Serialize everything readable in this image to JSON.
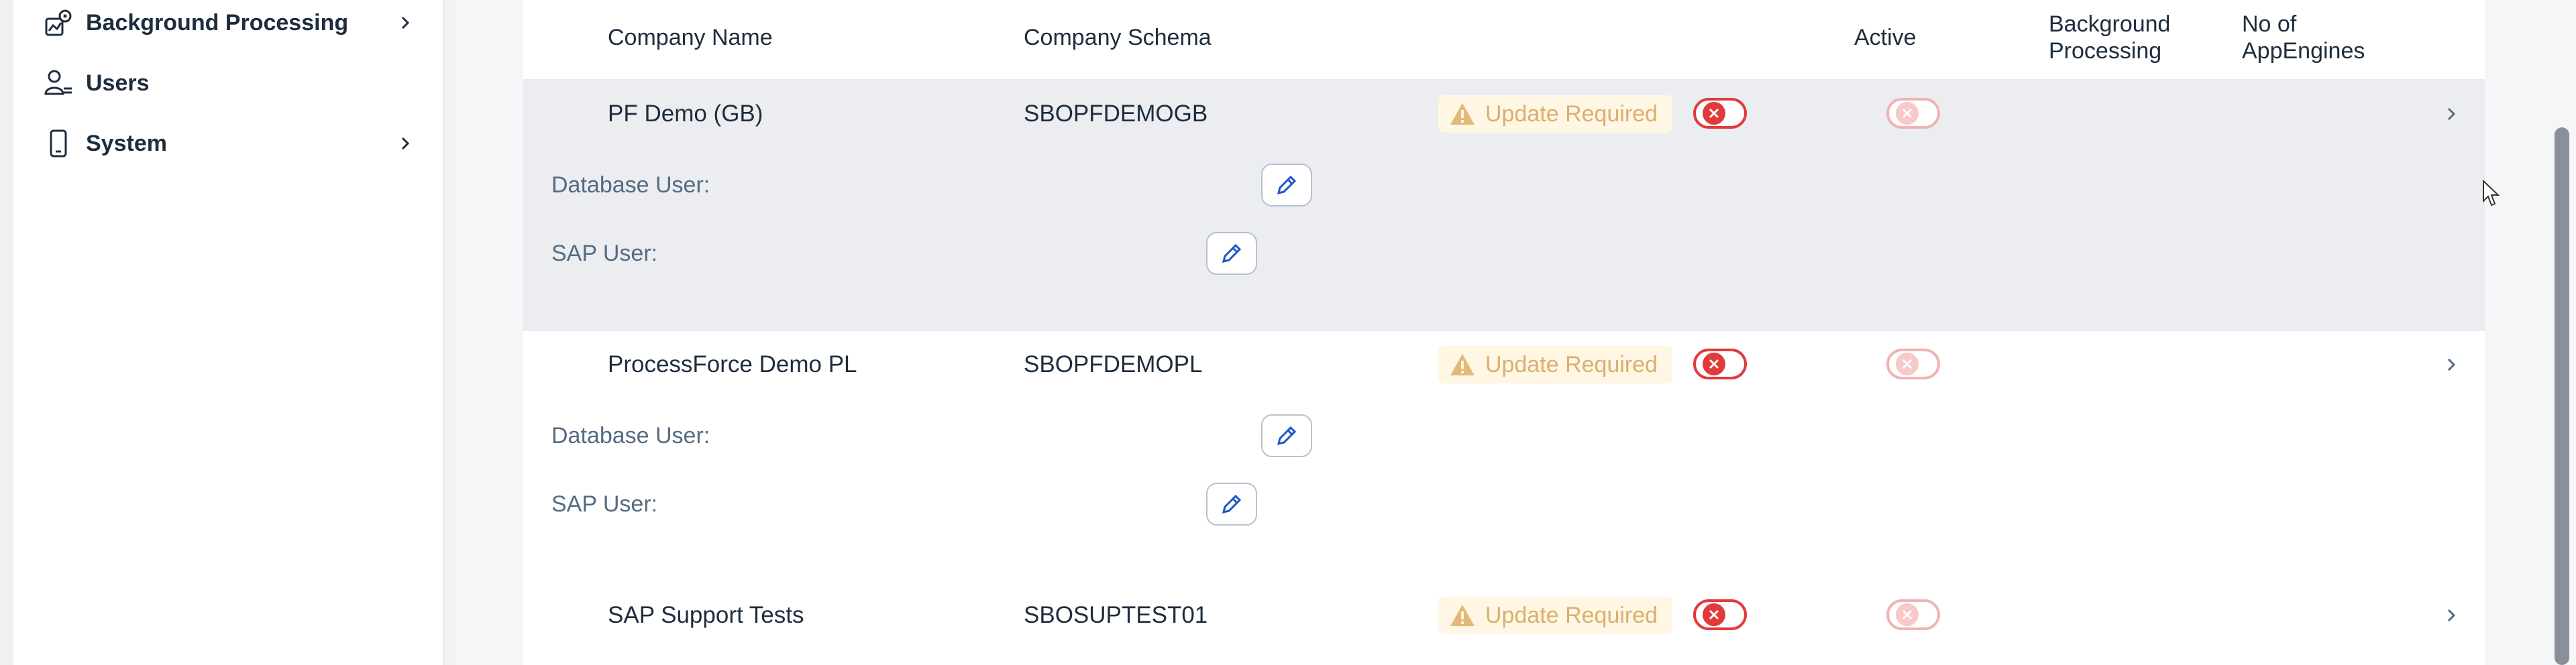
{
  "sidebar": {
    "items": [
      {
        "label": "Background Processing",
        "icon": "background-processing-icon",
        "has_chevron": true
      },
      {
        "label": "Users",
        "icon": "users-icon",
        "has_chevron": false
      },
      {
        "label": "System",
        "icon": "system-device-icon",
        "has_chevron": true
      }
    ]
  },
  "table": {
    "columns": [
      "Company Name",
      "Company Schema",
      "Active",
      "Background Processing",
      "No of AppEngines"
    ],
    "rows": [
      {
        "company_name": "PF Demo (GB)",
        "company_schema": "SBOPFDEMOGB",
        "status": "Update Required",
        "database_user_label": "Database User:",
        "sap_user_label": "SAP User:",
        "active": false,
        "background_processing": false,
        "selected": true
      },
      {
        "company_name": "ProcessForce Demo PL",
        "company_schema": "SBOPFDEMOPL",
        "status": "Update Required",
        "database_user_label": "Database User:",
        "sap_user_label": "SAP User:",
        "active": false,
        "background_processing": false,
        "selected": false
      },
      {
        "company_name": "SAP Support Tests",
        "company_schema": "SBOSUPTEST01",
        "status": "Update Required",
        "active": false,
        "background_processing": false,
        "selected": false
      }
    ]
  },
  "colors": {
    "accent": "#0a6ed1",
    "toggle_off": "#e03a3a",
    "warning_bg": "#fff6e3",
    "warning_text": "#dbaf6e"
  }
}
